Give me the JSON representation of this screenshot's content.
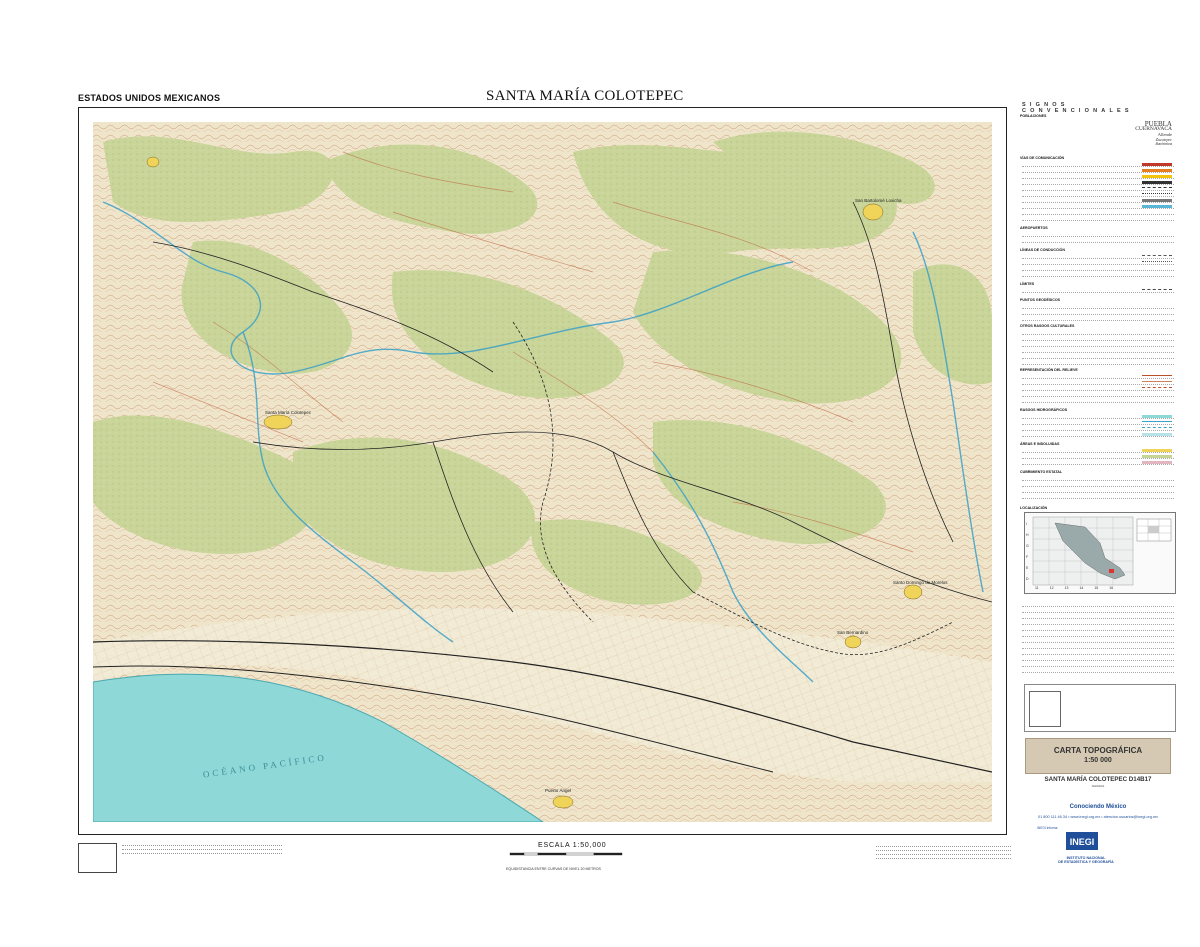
{
  "header": {
    "country": "ESTADOS UNIDOS MEXICANOS",
    "sheet_title": "SANTA MARÍA COLOTEPEC"
  },
  "map": {
    "ocean_label": "OCÉANO PACÍFICO",
    "colors": {
      "ocean": "#8fd8d8",
      "vegetation": "#c9d69a",
      "terrain": "#efe7cf",
      "contour": "#b9502a",
      "river": "#3aa0c8",
      "road": "#222222",
      "town": "#f0d45a"
    },
    "places": [
      "Santa María Colotepec",
      "San Bartolomé Loxicha",
      "Santo Domingo de Morelos",
      "San Bernardino",
      "Puerto Ángel"
    ]
  },
  "legend": {
    "title": "SIGNOS CONVENCIONALES",
    "sections": {
      "poblaciones": "POBLACIONES",
      "vias": "VÍAS DE COMUNICACIÓN",
      "aeropuertos": "AEROPUERTOS",
      "lineas": "LÍNEAS DE CONDUCCIÓN",
      "limites": "LÍMITES",
      "puntos": "PUNTOS GEODÉSICOS",
      "rasgos_culturales": "OTROS RASGOS CULTURALES",
      "relieve": "REPRESENTACIÓN DEL RELIEVE",
      "hidrograficos": "RASGOS HIDROGRÁFICOS",
      "areas": "ÁREAS E INDOLUIDAS",
      "cubrimiento": "CUBRIMIENTO ESTATAL",
      "localizacion": "LOCALIZACIÓN"
    },
    "example_towns": {
      "puebla": "PUEBLA",
      "cuernavaca": "CUERNAVACA",
      "allende": "Allende",
      "zacatepec": "Zacatepec",
      "bachiniva": "Bachiniva"
    },
    "index_rows": [
      "I",
      "H",
      "G",
      "F",
      "E",
      "D"
    ],
    "index_cols": [
      "11",
      "12",
      "13",
      "14",
      "15",
      "16"
    ],
    "carta_title": "CARTA TOPOGRÁFICA",
    "carta_scale": "1:50 000",
    "sheet_id": "SANTA MARÍA COLOTEPEC D14B17",
    "sheet_state": "OAXACA",
    "tagline": "Conociendo México",
    "contact": "01 800 111 46 34 • www.inegi.org.mx • atencion.usuarios@inegi.org.mx",
    "social": "INEGI Informa",
    "inegi_acronym": "INEGI",
    "inegi_name_1": "INSTITUTO NACIONAL",
    "inegi_name_2": "DE ESTADÍSTICA Y GEOGRAFÍA"
  },
  "footer": {
    "scale_label": "ESCALA 1:50,000",
    "equidistance": "EQUIDISTANCIA ENTRE CURVAS DE NIVEL 20 METROS"
  }
}
